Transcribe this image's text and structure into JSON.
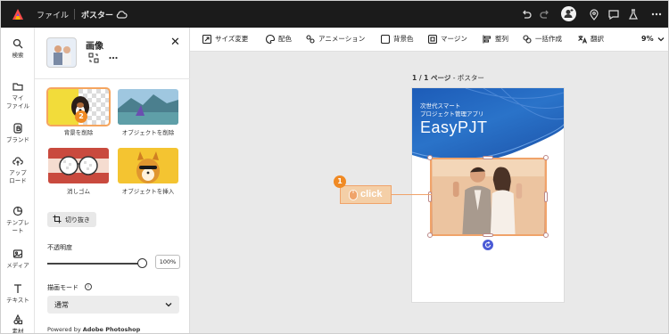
{
  "topbar": {
    "file_label": "ファイル",
    "doc_title": "ポスター"
  },
  "rail": {
    "items": [
      {
        "label": "検索",
        "icon": "search-icon"
      },
      {
        "label": "マイ\nファイル",
        "icon": "folder-icon"
      },
      {
        "label": "ブランド",
        "icon": "brand-icon"
      },
      {
        "label": "アップ\nロード",
        "icon": "upload-icon"
      },
      {
        "label": "テンプレ\nート",
        "icon": "template-icon"
      },
      {
        "label": "メディア",
        "icon": "media-icon"
      },
      {
        "label": "テキスト",
        "icon": "text-icon"
      },
      {
        "label": "素材",
        "icon": "elements-icon"
      }
    ]
  },
  "panel": {
    "title": "画像",
    "tiles": [
      {
        "label": "背景を削除"
      },
      {
        "label": "オブジェクトを削除"
      },
      {
        "label": "消しゴム"
      },
      {
        "label": "オブジェクトを挿入"
      }
    ],
    "crop_label": "切り抜き",
    "opacity_label": "不透明度",
    "opacity_value": "100%",
    "opacity_level": 1.0,
    "blend_label": "描画モード",
    "blend_value": "通常",
    "powered_prefix": "Powered by ",
    "powered_brand": "Adobe Photoshop"
  },
  "toolbar": {
    "items": [
      {
        "label": "サイズ変更",
        "icon": "resize-icon"
      },
      {
        "label": "配色",
        "icon": "palette-icon"
      },
      {
        "label": "アニメーション",
        "icon": "animation-icon"
      },
      {
        "label": "背景色",
        "icon": "background-color-icon"
      },
      {
        "label": "マージン",
        "icon": "margin-icon"
      },
      {
        "label": "整列",
        "icon": "align-icon"
      },
      {
        "label": "一括作成",
        "icon": "bulk-create-icon"
      },
      {
        "label": "翻訳",
        "icon": "translate-icon"
      }
    ],
    "zoom": "9%"
  },
  "canvas": {
    "page_label_bold": "1 / 1 ページ",
    "page_label_rest": " - ポスター",
    "poster_sub1": "次世代スマート",
    "poster_sub2": "プロジェクト管理アプリ",
    "poster_title": "EasyPJT"
  },
  "annotations": {
    "step1": "1",
    "step2": "2",
    "click_text": "click"
  },
  "colors": {
    "accent_orange": "#f08a24",
    "topbar_bg": "#1b1b1b",
    "poster_blue": "#1d5cb8",
    "rotate_handle": "#4b5bd6"
  }
}
